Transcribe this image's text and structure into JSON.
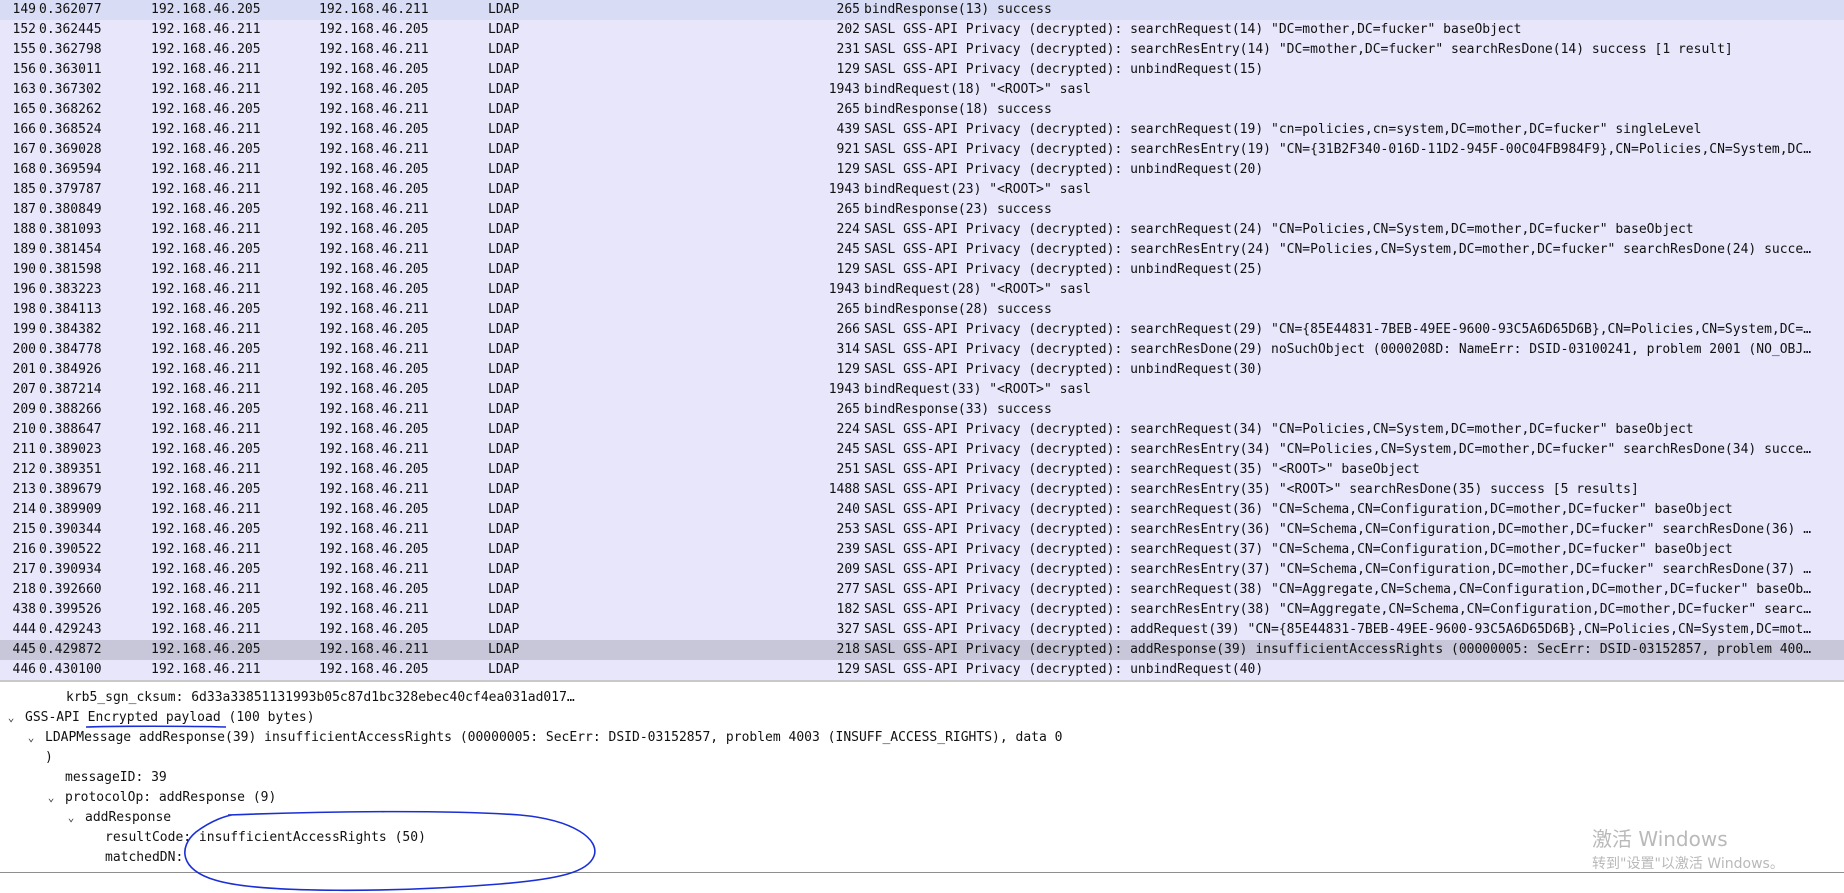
{
  "packets": [
    {
      "no": "149",
      "time": "0.362077",
      "src": "192.168.46.205",
      "dst": "192.168.46.211",
      "proto": "LDAP",
      "len": "265",
      "info": "bindResponse(13) success"
    },
    {
      "no": "152",
      "time": "0.362445",
      "src": "192.168.46.211",
      "dst": "192.168.46.205",
      "proto": "LDAP",
      "len": "202",
      "info": "SASL GSS-API Privacy (decrypted): searchRequest(14) \"DC=mother,DC=fucker\" baseObject"
    },
    {
      "no": "155",
      "time": "0.362798",
      "src": "192.168.46.205",
      "dst": "192.168.46.211",
      "proto": "LDAP",
      "len": "231",
      "info": "SASL GSS-API Privacy (decrypted): searchResEntry(14) \"DC=mother,DC=fucker\" searchResDone(14) success  [1 result]"
    },
    {
      "no": "156",
      "time": "0.363011",
      "src": "192.168.46.211",
      "dst": "192.168.46.205",
      "proto": "LDAP",
      "len": "129",
      "info": "SASL GSS-API Privacy (decrypted): unbindRequest(15)"
    },
    {
      "no": "163",
      "time": "0.367302",
      "src": "192.168.46.211",
      "dst": "192.168.46.205",
      "proto": "LDAP",
      "len": "1943",
      "info": "bindRequest(18) \"<ROOT>\" sasl"
    },
    {
      "no": "165",
      "time": "0.368262",
      "src": "192.168.46.205",
      "dst": "192.168.46.211",
      "proto": "LDAP",
      "len": "265",
      "info": "bindResponse(18) success"
    },
    {
      "no": "166",
      "time": "0.368524",
      "src": "192.168.46.211",
      "dst": "192.168.46.205",
      "proto": "LDAP",
      "len": "439",
      "info": "SASL GSS-API Privacy (decrypted): searchRequest(19) \"cn=policies,cn=system,DC=mother,DC=fucker\" singleLevel"
    },
    {
      "no": "167",
      "time": "0.369028",
      "src": "192.168.46.205",
      "dst": "192.168.46.211",
      "proto": "LDAP",
      "len": "921",
      "info": "SASL GSS-API Privacy (decrypted): searchResEntry(19) \"CN={31B2F340-016D-11D2-945F-00C04FB984F9},CN=Policies,CN=System,DC…"
    },
    {
      "no": "168",
      "time": "0.369594",
      "src": "192.168.46.211",
      "dst": "192.168.46.205",
      "proto": "LDAP",
      "len": "129",
      "info": "SASL GSS-API Privacy (decrypted): unbindRequest(20)"
    },
    {
      "no": "185",
      "time": "0.379787",
      "src": "192.168.46.211",
      "dst": "192.168.46.205",
      "proto": "LDAP",
      "len": "1943",
      "info": "bindRequest(23) \"<ROOT>\" sasl"
    },
    {
      "no": "187",
      "time": "0.380849",
      "src": "192.168.46.205",
      "dst": "192.168.46.211",
      "proto": "LDAP",
      "len": "265",
      "info": "bindResponse(23) success"
    },
    {
      "no": "188",
      "time": "0.381093",
      "src": "192.168.46.211",
      "dst": "192.168.46.205",
      "proto": "LDAP",
      "len": "224",
      "info": "SASL GSS-API Privacy (decrypted): searchRequest(24) \"CN=Policies,CN=System,DC=mother,DC=fucker\" baseObject"
    },
    {
      "no": "189",
      "time": "0.381454",
      "src": "192.168.46.205",
      "dst": "192.168.46.211",
      "proto": "LDAP",
      "len": "245",
      "info": "SASL GSS-API Privacy (decrypted): searchResEntry(24) \"CN=Policies,CN=System,DC=mother,DC=fucker\" searchResDone(24) succe…"
    },
    {
      "no": "190",
      "time": "0.381598",
      "src": "192.168.46.211",
      "dst": "192.168.46.205",
      "proto": "LDAP",
      "len": "129",
      "info": "SASL GSS-API Privacy (decrypted): unbindRequest(25)"
    },
    {
      "no": "196",
      "time": "0.383223",
      "src": "192.168.46.211",
      "dst": "192.168.46.205",
      "proto": "LDAP",
      "len": "1943",
      "info": "bindRequest(28) \"<ROOT>\" sasl"
    },
    {
      "no": "198",
      "time": "0.384113",
      "src": "192.168.46.205",
      "dst": "192.168.46.211",
      "proto": "LDAP",
      "len": "265",
      "info": "bindResponse(28) success"
    },
    {
      "no": "199",
      "time": "0.384382",
      "src": "192.168.46.211",
      "dst": "192.168.46.205",
      "proto": "LDAP",
      "len": "266",
      "info": "SASL GSS-API Privacy (decrypted): searchRequest(29) \"CN={85E44831-7BEB-49EE-9600-93C5A6D65D6B},CN=Policies,CN=System,DC=…"
    },
    {
      "no": "200",
      "time": "0.384778",
      "src": "192.168.46.205",
      "dst": "192.168.46.211",
      "proto": "LDAP",
      "len": "314",
      "info": "SASL GSS-API Privacy (decrypted): searchResDone(29) noSuchObject (0000208D: NameErr: DSID-03100241, problem 2001 (NO_OBJ…"
    },
    {
      "no": "201",
      "time": "0.384926",
      "src": "192.168.46.211",
      "dst": "192.168.46.205",
      "proto": "LDAP",
      "len": "129",
      "info": "SASL GSS-API Privacy (decrypted): unbindRequest(30)"
    },
    {
      "no": "207",
      "time": "0.387214",
      "src": "192.168.46.211",
      "dst": "192.168.46.205",
      "proto": "LDAP",
      "len": "1943",
      "info": "bindRequest(33) \"<ROOT>\" sasl"
    },
    {
      "no": "209",
      "time": "0.388266",
      "src": "192.168.46.205",
      "dst": "192.168.46.211",
      "proto": "LDAP",
      "len": "265",
      "info": "bindResponse(33) success"
    },
    {
      "no": "210",
      "time": "0.388647",
      "src": "192.168.46.211",
      "dst": "192.168.46.205",
      "proto": "LDAP",
      "len": "224",
      "info": "SASL GSS-API Privacy (decrypted): searchRequest(34) \"CN=Policies,CN=System,DC=mother,DC=fucker\" baseObject"
    },
    {
      "no": "211",
      "time": "0.389023",
      "src": "192.168.46.205",
      "dst": "192.168.46.211",
      "proto": "LDAP",
      "len": "245",
      "info": "SASL GSS-API Privacy (decrypted): searchResEntry(34) \"CN=Policies,CN=System,DC=mother,DC=fucker\" searchResDone(34) succe…"
    },
    {
      "no": "212",
      "time": "0.389351",
      "src": "192.168.46.211",
      "dst": "192.168.46.205",
      "proto": "LDAP",
      "len": "251",
      "info": "SASL GSS-API Privacy (decrypted): searchRequest(35) \"<ROOT>\" baseObject"
    },
    {
      "no": "213",
      "time": "0.389679",
      "src": "192.168.46.205",
      "dst": "192.168.46.211",
      "proto": "LDAP",
      "len": "1488",
      "info": "SASL GSS-API Privacy (decrypted): searchResEntry(35) \"<ROOT>\" searchResDone(35) success  [5 results]"
    },
    {
      "no": "214",
      "time": "0.389909",
      "src": "192.168.46.211",
      "dst": "192.168.46.205",
      "proto": "LDAP",
      "len": "240",
      "info": "SASL GSS-API Privacy (decrypted): searchRequest(36) \"CN=Schema,CN=Configuration,DC=mother,DC=fucker\" baseObject"
    },
    {
      "no": "215",
      "time": "0.390344",
      "src": "192.168.46.205",
      "dst": "192.168.46.211",
      "proto": "LDAP",
      "len": "253",
      "info": "SASL GSS-API Privacy (decrypted): searchResEntry(36) \"CN=Schema,CN=Configuration,DC=mother,DC=fucker\" searchResDone(36) …"
    },
    {
      "no": "216",
      "time": "0.390522",
      "src": "192.168.46.211",
      "dst": "192.168.46.205",
      "proto": "LDAP",
      "len": "239",
      "info": "SASL GSS-API Privacy (decrypted): searchRequest(37) \"CN=Schema,CN=Configuration,DC=mother,DC=fucker\" baseObject"
    },
    {
      "no": "217",
      "time": "0.390934",
      "src": "192.168.46.205",
      "dst": "192.168.46.211",
      "proto": "LDAP",
      "len": "209",
      "info": "SASL GSS-API Privacy (decrypted): searchResEntry(37) \"CN=Schema,CN=Configuration,DC=mother,DC=fucker\" searchResDone(37) …"
    },
    {
      "no": "218",
      "time": "0.392660",
      "src": "192.168.46.211",
      "dst": "192.168.46.205",
      "proto": "LDAP",
      "len": "277",
      "info": "SASL GSS-API Privacy (decrypted): searchRequest(38) \"CN=Aggregate,CN=Schema,CN=Configuration,DC=mother,DC=fucker\" baseOb…"
    },
    {
      "no": "438",
      "time": "0.399526",
      "src": "192.168.46.205",
      "dst": "192.168.46.211",
      "proto": "LDAP",
      "len": "182",
      "info": "SASL GSS-API Privacy (decrypted): searchResEntry(38) \"CN=Aggregate,CN=Schema,CN=Configuration,DC=mother,DC=fucker\" searc…"
    },
    {
      "no": "444",
      "time": "0.429243",
      "src": "192.168.46.211",
      "dst": "192.168.46.205",
      "proto": "LDAP",
      "len": "327",
      "info": "SASL GSS-API Privacy (decrypted): addRequest(39) \"CN={85E44831-7BEB-49EE-9600-93C5A6D65D6B},CN=Policies,CN=System,DC=mot…"
    },
    {
      "no": "445",
      "time": "0.429872",
      "src": "192.168.46.205",
      "dst": "192.168.46.211",
      "proto": "LDAP",
      "len": "218",
      "info": "SASL GSS-API Privacy (decrypted): addResponse(39) insufficientAccessRights (00000005: SecErr: DSID-03152857, problem 400…"
    },
    {
      "no": "446",
      "time": "0.430100",
      "src": "192.168.46.211",
      "dst": "192.168.46.205",
      "proto": "LDAP",
      "len": "129",
      "info": "SASL GSS-API Privacy (decrypted): unbindRequest(40)"
    }
  ],
  "selected_packet_no": "445",
  "detail": {
    "cksum": "krb5_sgn_cksum: 6d33a33851131993b05c87d1bc328ebec40cf4ea031ad017…",
    "gss_api": "GSS-API Encrypted payload (100 bytes)",
    "ldap_message": "LDAPMessage addResponse(39) insufficientAccessRights (00000005: SecErr: DSID-03152857, problem 4003 (INSUFF_ACCESS_RIGHTS), data 0",
    "ldap_message_cont": ")",
    "message_id": "messageID: 39",
    "protocol_op": "protocolOp: addResponse (9)",
    "add_response": "addResponse",
    "result_code": "resultCode: insufficientAccessRights (50)",
    "matched_dn": "matchedDN:"
  },
  "watermark": {
    "title": "激活 Windows",
    "subtitle": "转到\"设置\"以激活 Windows。"
  },
  "colors": {
    "list_bg": "#e8e6fb",
    "first_row_bg": "#d8dcf5",
    "selected_row_bg": "#c8c7d9",
    "annotation_ink": "#1a2fd6"
  },
  "icons": {
    "expand": "chevron-down-icon"
  }
}
